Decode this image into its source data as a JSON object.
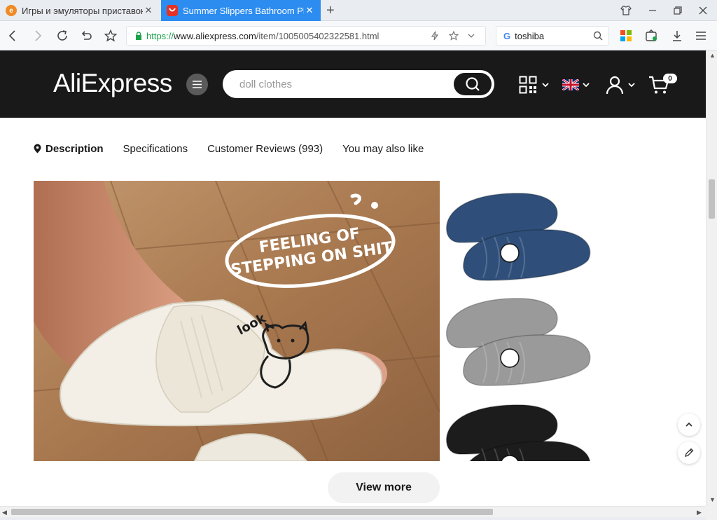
{
  "browser": {
    "tabs": [
      {
        "title": "Игры и эмуляторы приставок",
        "active": false,
        "favicon": "orange-globe-icon"
      },
      {
        "title": "Summer Slippers Bathroom Pl",
        "active": true,
        "favicon": "aliexpress-icon"
      }
    ],
    "address": {
      "protocol": "https://",
      "host": "www.aliexpress.com",
      "path": "/item/1005005402322581.html"
    },
    "search_value": "toshiba",
    "accent_color": "#2d8cf0"
  },
  "site": {
    "logo": "AliExpress",
    "search_placeholder": "doll clothes",
    "cart_count": "0",
    "header_bg": "#191919"
  },
  "subnav": {
    "items": [
      {
        "label": "Description",
        "active": true
      },
      {
        "label": "Specifications",
        "active": false
      },
      {
        "label": "Customer Reviews (993)",
        "active": false
      },
      {
        "label": "You may also like",
        "active": false
      }
    ]
  },
  "product_image": {
    "caption_line1": "FEELING OF",
    "caption_line2": "STEPPING ON SHIT",
    "slipper_text": "look",
    "variants": [
      {
        "color": "#2f4f7a"
      },
      {
        "color": "#9a9a9a"
      },
      {
        "color": "#1c1c1c"
      }
    ]
  },
  "view_more_label": "View more"
}
